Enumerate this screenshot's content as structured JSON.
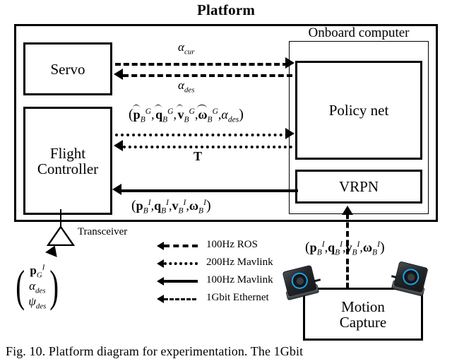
{
  "figure": {
    "title": "Platform",
    "caption": "Fig. 10. Platform diagram for experimentation. The 1Gbit"
  },
  "blocks": {
    "servo": "Servo",
    "flight_controller": "Flight\nController",
    "flight_controller_line1": "Flight",
    "flight_controller_line2": "Controller",
    "onboard_computer": "Onboard computer",
    "policy_net": "Policy net",
    "vrpn": "VRPN",
    "motion_capture_line1": "Motion",
    "motion_capture_line2": "Capture",
    "transceiver": "Transceiver"
  },
  "signals": {
    "alpha_cur": "α_cur",
    "alpha_des": "α_des",
    "policy_input": "(p̂_B^G, q̂_B^G, v̂_B^G, ω̂_B^G, α_des)",
    "thrust": "T",
    "state_inertial": "(p_B^I, q_B^I, v_B^I, ω_B^I)",
    "mocap_state": "(p_B^I, q_B^I, v_B^I, ω_B^I)",
    "ground_command": [
      "p_G^I",
      "α_des",
      "ψ_des"
    ]
  },
  "legend": {
    "items": [
      {
        "label": "100Hz ROS",
        "style": "dashed"
      },
      {
        "label": "200Hz Mavlink",
        "style": "dotted"
      },
      {
        "label": "100Hz Mavlink",
        "style": "solid"
      },
      {
        "label": "1Gbit Ethernet",
        "style": "fine-dashed"
      }
    ]
  },
  "colors": {
    "stroke": "#000000",
    "background": "#ffffff",
    "camera_ring": "#1aa3e8",
    "camera_body": "#23262a"
  }
}
